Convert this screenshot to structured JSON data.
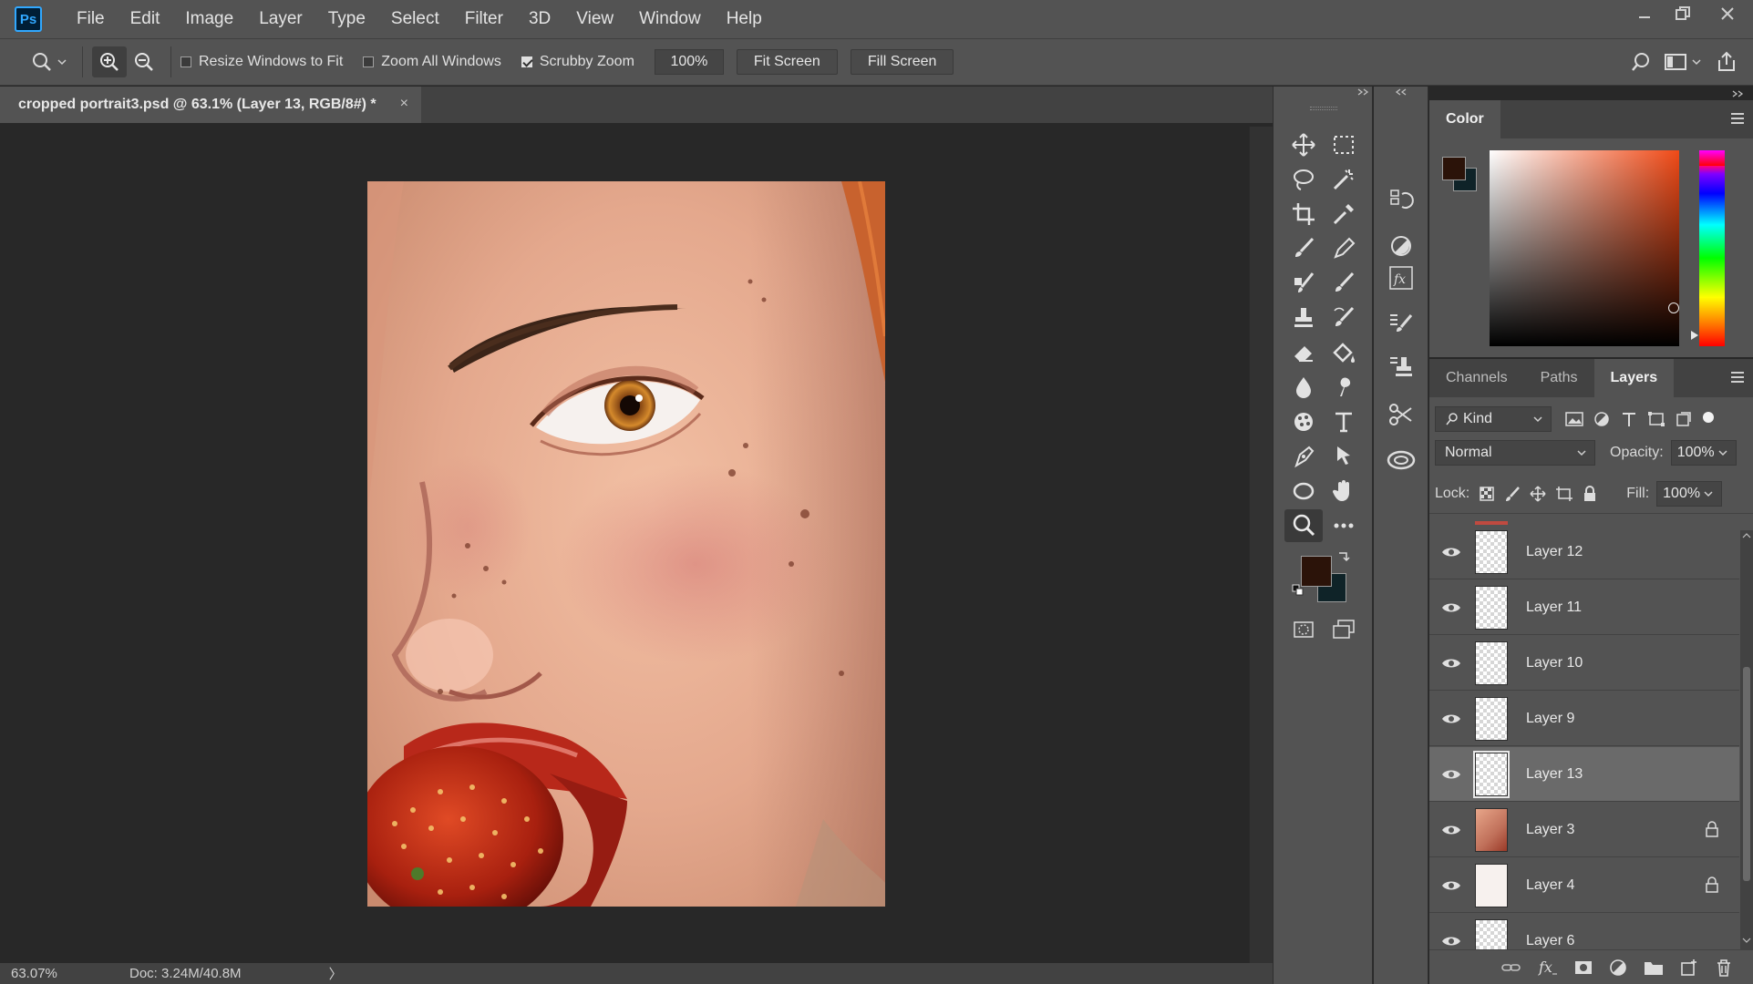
{
  "app": {
    "logo": "Ps",
    "menu": [
      "File",
      "Edit",
      "Image",
      "Layer",
      "Type",
      "Select",
      "Filter",
      "3D",
      "View",
      "Window",
      "Help"
    ]
  },
  "options": {
    "resize_windows": "Resize Windows to Fit",
    "resize_windows_checked": false,
    "zoom_all": "Zoom All Windows",
    "zoom_all_checked": false,
    "scrubby_zoom": "Scrubby Zoom",
    "scrubby_zoom_checked": true,
    "zoom_value": "100%",
    "fit_screen": "Fit Screen",
    "fill_screen": "Fill Screen"
  },
  "document": {
    "tab_title": "cropped portrait3.psd @ 63.1% (Layer 13, RGB/8#) *",
    "close": "×"
  },
  "status": {
    "zoom": "63.07%",
    "doc": "Doc: 3.24M/40.8M",
    "arrow": "〉"
  },
  "colors": {
    "foreground": "#2b1309",
    "background": "#0f2328",
    "picker_hue": "#f04a17"
  },
  "color_panel": {
    "title": "Color"
  },
  "layers_panel": {
    "tabs": [
      "Channels",
      "Paths",
      "Layers"
    ],
    "active_tab": "Layers",
    "filter_kind": "Kind",
    "blend_mode": "Normal",
    "opacity_label": "Opacity:",
    "opacity_value": "100%",
    "lock_label": "Lock:",
    "fill_label": "Fill:",
    "fill_value": "100%",
    "layers": [
      {
        "name": "Layer 12",
        "visible": true,
        "locked": false,
        "selected": false
      },
      {
        "name": "Layer 11",
        "visible": true,
        "locked": false,
        "selected": false
      },
      {
        "name": "Layer 10",
        "visible": true,
        "locked": false,
        "selected": false
      },
      {
        "name": "Layer 9",
        "visible": true,
        "locked": false,
        "selected": false
      },
      {
        "name": "Layer 13",
        "visible": true,
        "locked": false,
        "selected": true
      },
      {
        "name": "Layer 3",
        "visible": true,
        "locked": true,
        "selected": false
      },
      {
        "name": "Layer 4",
        "visible": true,
        "locked": true,
        "selected": false
      },
      {
        "name": "Layer 6",
        "visible": true,
        "locked": false,
        "selected": false
      }
    ]
  },
  "tools": [
    "move-tool-icon",
    "marquee-tool-icon",
    "lasso-tool-icon",
    "magic-wand-tool-icon",
    "crop-tool-icon",
    "eyedropper-tool-icon",
    "brush-tool-icon",
    "pencil-tool-icon",
    "healing-brush-tool-icon",
    "mixer-brush-tool-icon",
    "clone-stamp-tool-icon",
    "history-brush-tool-icon",
    "eraser-tool-icon",
    "paint-bucket-tool-icon",
    "blur-tool-icon",
    "smudge-tool-icon",
    "sponge-tool-icon",
    "type-tool-icon",
    "pen-tool-icon",
    "path-selection-tool-icon",
    "ellipse-tool-icon",
    "hand-tool-icon",
    "zoom-tool-icon",
    "more-tools-icon"
  ]
}
